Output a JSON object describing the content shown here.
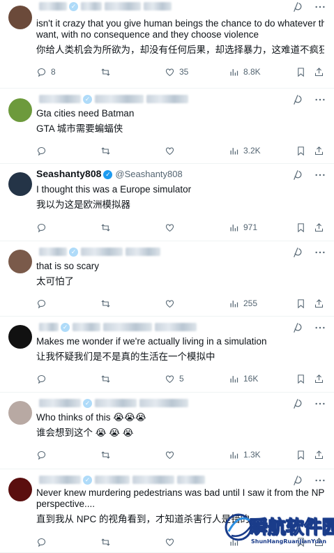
{
  "tweets": [
    {
      "name": "",
      "handle": "",
      "lines": [
        "isn't it crazy that you give human beings the chance to do whatever they",
        "want, with no consequence and they choose violence",
        "你给人类机会为所欲为，却没有任何后果，却选择暴力，这难道不疯狂吗？"
      ],
      "replies": "8",
      "reposts": "",
      "likes": "35",
      "views": "8.8K",
      "avatar_color": "#6b4a3a"
    },
    {
      "name": "",
      "handle": "",
      "lines": [
        "Gta cities need Batman",
        "GTA 城市需要蝙蝠侠"
      ],
      "replies": "",
      "reposts": "",
      "likes": "",
      "views": "3.2K",
      "avatar_color": "#6d9a3c"
    },
    {
      "name": "Seashanty808",
      "handle": "@Seashanty808",
      "lines": [
        "I thought this was a Europe simulator",
        "我以为这是欧洲模拟器"
      ],
      "replies": "",
      "reposts": "",
      "likes": "",
      "views": "971",
      "avatar_color": "#243447"
    },
    {
      "name": "",
      "handle": "",
      "lines": [
        "that is so scary",
        "太可怕了"
      ],
      "replies": "",
      "reposts": "",
      "likes": "",
      "views": "255",
      "avatar_color": "#7a5a4a"
    },
    {
      "name": "",
      "handle": "",
      "lines": [
        "Makes me wonder if we're actually living in a simulation",
        "让我怀疑我们是不是真的生活在一个模拟中"
      ],
      "replies": "",
      "reposts": "",
      "likes": "5",
      "views": "16K",
      "avatar_color": "#111111"
    },
    {
      "name": "",
      "handle": "",
      "lines": [
        "Who thinks of this 😭😭😭",
        "谁会想到这个 😭 😭 😭"
      ],
      "replies": "",
      "reposts": "",
      "likes": "",
      "views": "1.3K",
      "avatar_color": "#b8a9a3"
    },
    {
      "name": "",
      "handle": "",
      "lines": [
        "Never knew murdering pedestrians was bad until I saw it from the NPCs",
        "perspective....",
        "直到我从 NPC 的视角看到，才知道杀害行人是错的"
      ],
      "replies": "",
      "reposts": "",
      "likes": "",
      "views": "",
      "avatar_color": "#5a0e0e"
    }
  ],
  "icons": {
    "grok": "grok-icon",
    "more": "more-icon",
    "reply": "reply-icon",
    "repost": "repost-icon",
    "like": "like-icon",
    "views": "views-icon",
    "bookmark": "bookmark-icon",
    "share": "share-icon"
  },
  "colors": {
    "verified": "#1d9bf0",
    "muted": "#536471",
    "text": "#0f1419"
  },
  "watermark": {
    "title": "瞬航软件园",
    "subtitle": "ShunHangRuanJianYuan"
  }
}
